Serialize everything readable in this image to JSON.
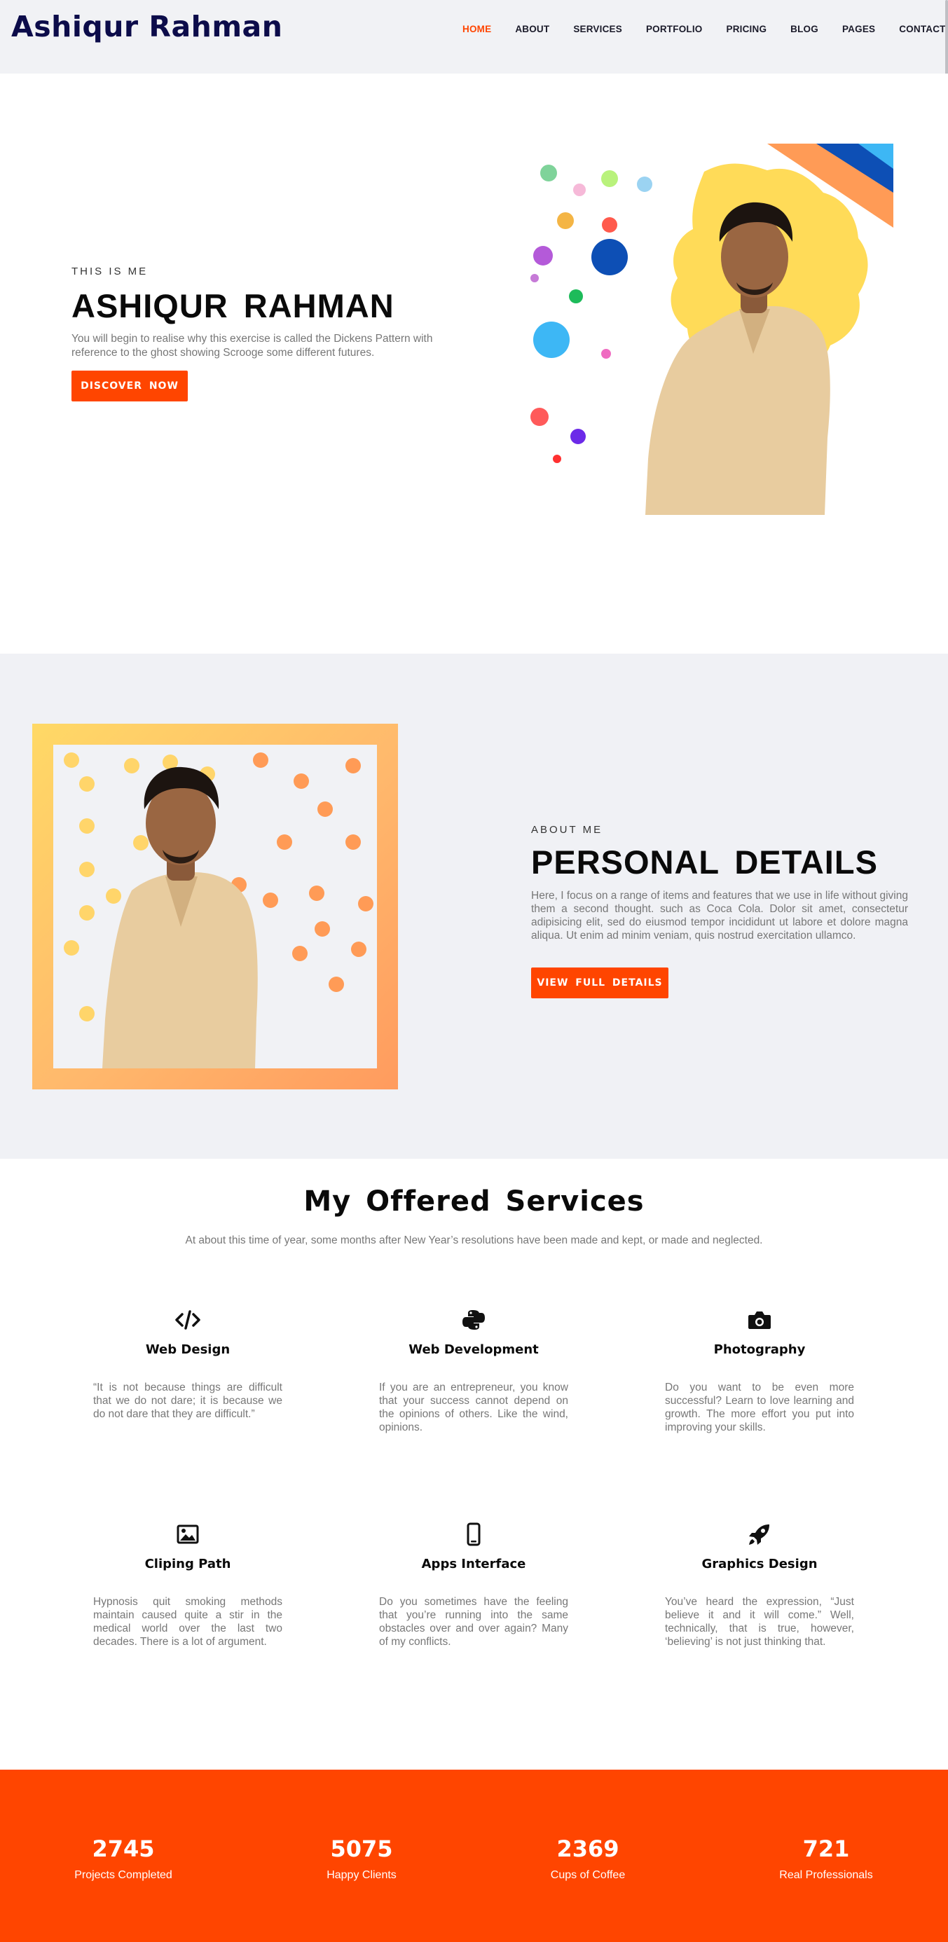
{
  "nav": {
    "brand": "Ashiqur Rahman",
    "items": [
      {
        "label": "HOME",
        "active": true
      },
      {
        "label": "ABOUT",
        "active": false
      },
      {
        "label": "SERVICES",
        "active": false
      },
      {
        "label": "PORTFOLIO",
        "active": false
      },
      {
        "label": "PRICING",
        "active": false
      },
      {
        "label": "BLOG",
        "active": false
      },
      {
        "label": "PAGES",
        "active": false
      },
      {
        "label": "CONTACT",
        "active": false
      }
    ]
  },
  "hero": {
    "eyebrow": "THIS IS ME",
    "title": "ASHIQUR RAHMAN",
    "description": "You will begin to realise why this exercise is called the Dickens Pattern with reference to the ghost showing Scrooge some different futures.",
    "button": "DISCOVER NOW"
  },
  "about": {
    "eyebrow": "ABOUT ME",
    "title": "PERSONAL DETAILS",
    "description": "Here, I focus on a range of items and features that we use in life without giving them a second thought. such as Coca Cola. Dolor sit amet, consectetur adipisicing elit, sed do eiusmod tempor incididunt ut labore et dolore magna aliqua. Ut enim ad minim veniam, quis nostrud exercitation ullamco.",
    "button": "VIEW FULL DETAILS"
  },
  "services": {
    "title": "My Offered Services",
    "subtitle": "At about this time of year, some months after New Year’s resolutions have been made and kept, or made and neglected.",
    "items": [
      {
        "icon": "code-icon",
        "name": "Web Design",
        "text": "“It is not because things are difficult that we do not dare; it is because we do not dare that they are difficult.”"
      },
      {
        "icon": "python-icon",
        "name": "Web Development",
        "text": "If you are an entrepreneur, you know that your success cannot depend on the opinions of others. Like the wind, opinions."
      },
      {
        "icon": "camera-icon",
        "name": "Photography",
        "text": "Do you want to be even more successful? Learn to love learning and growth. The more effort you put into improving your skills."
      },
      {
        "icon": "image-icon",
        "name": "Cliping Path",
        "text": "Hypnosis quit smoking methods maintain caused quite a stir in the medical world over the last two decades. There is a lot of argument."
      },
      {
        "icon": "mobile-icon",
        "name": "Apps Interface",
        "text": "Do you sometimes have the feeling that you’re running into the same obstacles over and over again? Many of my conflicts."
      },
      {
        "icon": "rocket-icon",
        "name": "Graphics Design",
        "text": "You’ve heard the expression, “Just believe it and it will come.” Well, technically, that is true, however, ‘believing’ is not just thinking that."
      }
    ]
  },
  "stats": [
    {
      "value": "2745",
      "label": "Projects Completed"
    },
    {
      "value": "5075",
      "label": "Happy Clients"
    },
    {
      "value": "2369",
      "label": "Cups of Coffee"
    },
    {
      "value": "721",
      "label": "Real Professionals"
    }
  ],
  "colors": {
    "accent": "#ff4500",
    "brand": "#0c0c4a"
  }
}
